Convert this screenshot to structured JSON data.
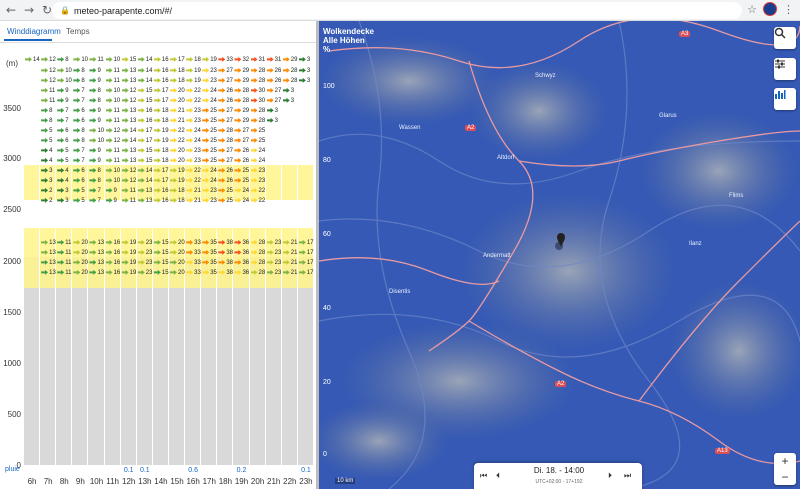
{
  "browser": {
    "url": "meteo-parapente.com/#/",
    "back_icon": "arrow-left-icon",
    "forward_icon": "arrow-right-icon",
    "reload_icon": "reload-icon"
  },
  "tabs": [
    {
      "label": "Winddiagramm",
      "active": true
    },
    {
      "label": "Temps",
      "active": false
    }
  ],
  "diagram": {
    "unit_label": "(m)",
    "altitudes": [
      "3500",
      "3000",
      "2500",
      "2000",
      "1500",
      "1000",
      "500",
      "0"
    ],
    "pluie_label": "pluie",
    "hours": [
      "6h",
      "7h",
      "8h",
      "9h",
      "10h",
      "11h",
      "12h",
      "13h",
      "14h",
      "15h",
      "16h",
      "17h",
      "18h",
      "19h",
      "20h",
      "21h",
      "22h",
      "23h"
    ],
    "rain": [
      "",
      "",
      "",
      "",
      "",
      "",
      "0.1",
      "0.1",
      "",
      "",
      "0.6",
      "",
      "",
      "0.2",
      "",
      "",
      "",
      "0.1"
    ],
    "top_numbers": [
      "14",
      "12",
      "8",
      "10",
      "11",
      "10",
      "15",
      "14",
      "16",
      "17",
      "18",
      "19",
      "33",
      "32",
      "31",
      "31",
      "29",
      "3"
    ],
    "row_numbers": [
      [
        "12",
        "10",
        "8",
        "9",
        "11",
        "13",
        "14",
        "16",
        "18",
        "19",
        "23",
        "27",
        "29",
        "28",
        "26",
        "28",
        "3"
      ],
      [
        "11",
        "9",
        "7",
        "8",
        "10",
        "12",
        "15",
        "17",
        "20",
        "22",
        "24",
        "26",
        "28",
        "30",
        "27",
        "3"
      ],
      [
        "8",
        "7",
        "6",
        "9",
        "11",
        "13",
        "16",
        "18",
        "21",
        "23",
        "25",
        "27",
        "29",
        "28",
        "3"
      ],
      [
        "5",
        "6",
        "8",
        "10",
        "12",
        "14",
        "17",
        "19",
        "22",
        "24",
        "25",
        "28",
        "27",
        "25"
      ],
      [
        "4",
        "5",
        "7",
        "9",
        "11",
        "13",
        "15",
        "18",
        "20",
        "23",
        "25",
        "27",
        "26",
        "24"
      ],
      [
        "3",
        "4",
        "6",
        "8",
        "10",
        "12",
        "14",
        "17",
        "19",
        "22",
        "24",
        "26",
        "25",
        "23"
      ],
      [
        "2",
        "3",
        "5",
        "7",
        "9",
        "11",
        "13",
        "16",
        "18",
        "21",
        "23",
        "25",
        "24",
        "22"
      ]
    ],
    "low_numbers": [
      "13",
      "11",
      "20",
      "13",
      "16",
      "19",
      "23",
      "15",
      "20",
      "33",
      "35",
      "38",
      "36",
      "28",
      "23",
      "21",
      "17"
    ]
  },
  "map": {
    "title": "Wolkendecke",
    "subtitle": "Alle Höhen",
    "unit": "%",
    "ticks": [
      "100",
      "80",
      "60",
      "40",
      "20",
      "0"
    ],
    "time": "Di. 18. - 14:00",
    "utc": "UTC+02:00 - 17+192",
    "scale": "10 km",
    "roads": [
      "A3",
      "A2",
      "A2",
      "A13"
    ],
    "places": [
      "Schwyz",
      "Altdorf",
      "Glarus",
      "Andermatt",
      "Disentis",
      "Flims",
      "Ilanz",
      "Wassen"
    ],
    "buttons": [
      "search-icon",
      "sliders-icon",
      "bar-chart-icon"
    ],
    "zoom_in": "+",
    "zoom_out": "−"
  },
  "colors": {
    "accent": "#1565c0",
    "map_blue": "#3b5fb0",
    "road": "#d84f5a",
    "yellow": "#fff58a"
  }
}
